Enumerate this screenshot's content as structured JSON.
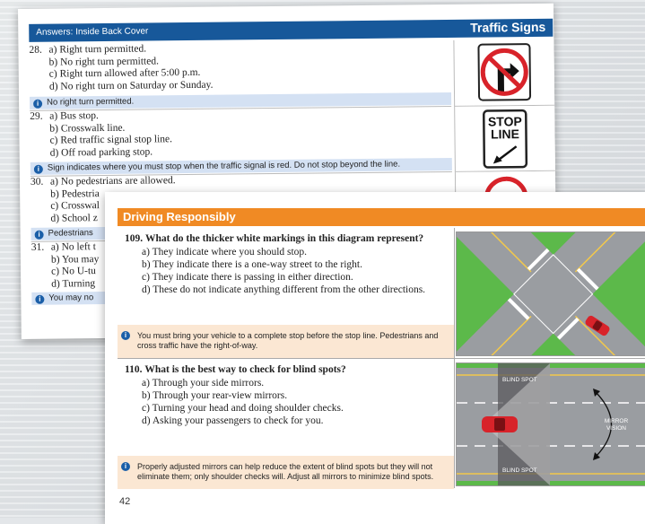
{
  "back_page": {
    "header_left": "Answers: Inside Back Cover",
    "header_right": "Traffic Signs",
    "questions": [
      {
        "number": "28.",
        "options": [
          "a) Right turn permitted.",
          "b) No right turn permitted.",
          "c) Right turn allowed after 5:00 p.m.",
          "d) No right turn on Saturday or Sunday."
        ],
        "answer": "No right turn permitted."
      },
      {
        "number": "29.",
        "options": [
          "a) Bus stop.",
          "b) Crosswalk line.",
          "c) Red traffic signal stop line.",
          "d) Off road parking stop."
        ],
        "answer": "Sign indicates where you must stop when the traffic signal is red. Do not stop beyond the line."
      },
      {
        "number": "30.",
        "options": [
          "a) No pedestrians are allowed.",
          "b) Pedestria",
          "c) Crosswal",
          "d) School z"
        ],
        "answer": "Pedestrians"
      },
      {
        "number": "31.",
        "options": [
          "a) No left t",
          "b) You may",
          "c) No U-tu",
          "d) Turning"
        ],
        "answer": "You may no"
      }
    ],
    "sign_stop_line": {
      "top": "STOP",
      "bottom": "LINE"
    }
  },
  "front_page": {
    "header": "Driving Responsibly",
    "questions": [
      {
        "number": "109.",
        "question": "What do the thicker white markings in this diagram represent?",
        "options": [
          "a) They indicate where you should stop.",
          "b) They indicate there is a one-way street to the right.",
          "c) They indicate there is passing in either direction.",
          "d) These do not indicate anything different from the other directions."
        ],
        "explanation": "You must bring your vehicle to a complete stop before the stop line. Pedestrians and cross traffic have the right-of-way."
      },
      {
        "number": "110.",
        "question": "What is the best way to check for blind spots?",
        "options": [
          "a) Through your side mirrors.",
          "b) Through your rear-view mirrors.",
          "c) Turning your head and doing shoulder checks.",
          "d) Asking your passengers to check for you."
        ],
        "explanation": "Properly adjusted mirrors can help reduce the extent of blind spots but they will not eliminate them; only shoulder checks will. Adjust all mirrors to minimize blind spots."
      }
    ],
    "diagram_labels": {
      "blind_spot_top": "BLIND SPOT",
      "blind_spot_bottom": "BLIND SPOT",
      "mirror": "MIRROR",
      "vision": "VISION"
    },
    "page_number": "42"
  },
  "colors": {
    "back_header": "#17589a",
    "front_header": "#f08a24",
    "answer_band": "#d4e1f3",
    "explanation_band": "#fbe7d3",
    "grass": "#5cb94a",
    "road": "#9a9da1",
    "car": "#d8232a"
  },
  "icons": [
    "info-icon",
    "no-right-turn-sign-icon",
    "stop-line-sign-icon",
    "car-icon",
    "arrow-icon"
  ]
}
